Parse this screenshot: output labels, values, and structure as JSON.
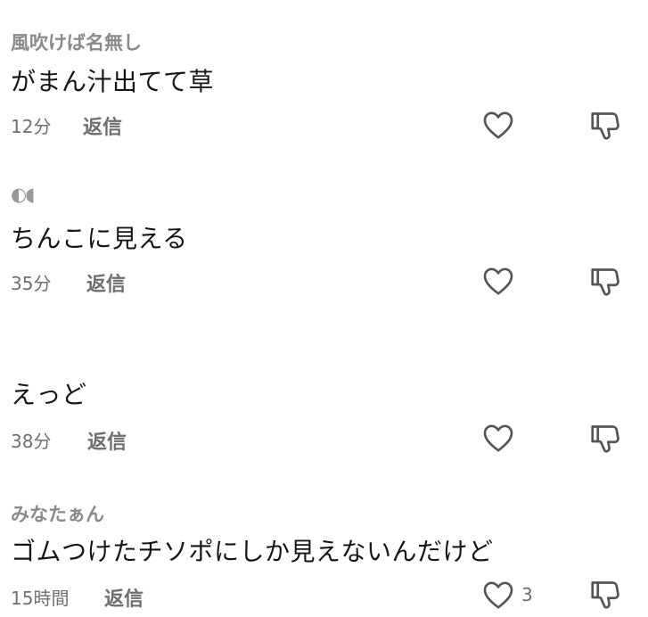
{
  "comments": [
    {
      "username": "風吹けば名無し",
      "text": "がまん汁出てて草",
      "time": "12分",
      "reply_label": "返信",
      "like_count": ""
    },
    {
      "username": "◐◖",
      "text": "ちんこに見える",
      "time": "35分",
      "reply_label": "返信",
      "like_count": ""
    },
    {
      "username": "",
      "text": "えっど",
      "time": "38分",
      "reply_label": "返信",
      "like_count": ""
    },
    {
      "username": "みなたぁん",
      "text": "ゴムつけたチソポにしか見えないんだけど",
      "time": "15時間",
      "reply_label": "返信",
      "like_count": "3"
    }
  ],
  "icons": {
    "like": "heart-outline-icon",
    "dislike": "thumbs-down-outline-icon"
  },
  "colors": {
    "text": "#161616",
    "secondary": "#6f6f6f",
    "username": "#8a8a8a",
    "icon": "#555555"
  }
}
